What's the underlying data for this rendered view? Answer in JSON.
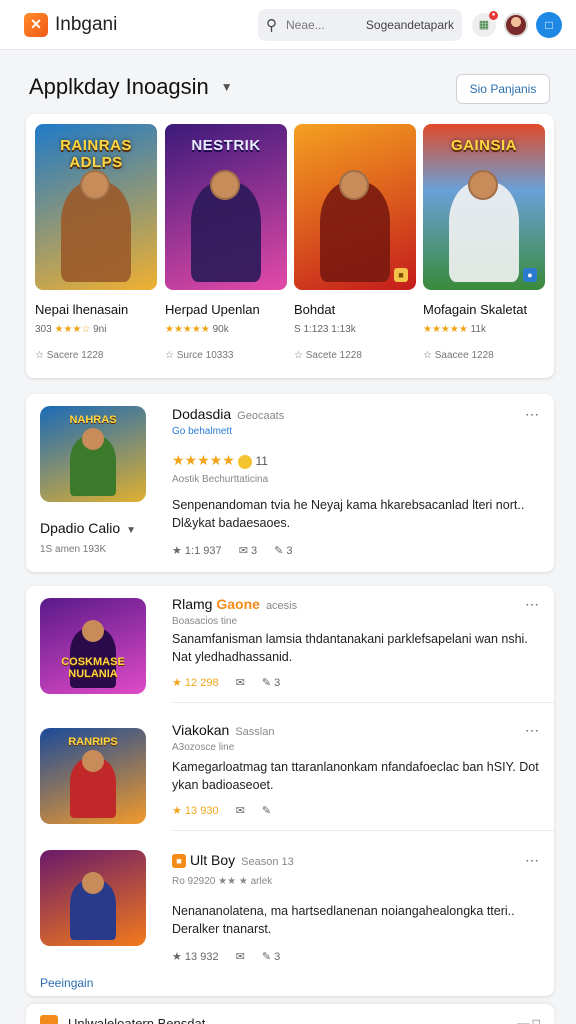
{
  "app": {
    "brand": "Inbgani",
    "logo_glyph": "✕"
  },
  "search": {
    "placeholder": "Neae...",
    "right_text": "Sogeandetapark"
  },
  "section": {
    "title": "Applkday Inoagsin",
    "button": "Sio Panjanis"
  },
  "featured": [
    {
      "art_title": "RAINRAS ADLPS",
      "name": "Nepai lhenasain",
      "meta_prefix": "303",
      "stars": "★★★☆",
      "meta_suffix": "9ni",
      "foot": "Sacere 1228",
      "colors": [
        "#1f7ac8",
        "#f0b030"
      ],
      "fig": "#9a5a2a"
    },
    {
      "art_title": "NESTRIK",
      "name": "Herpad Upenlan",
      "meta_prefix": "",
      "stars": "★★★★★",
      "meta_suffix": "90k",
      "foot": "Surce 10333",
      "colors": [
        "#3b1a7a",
        "#e44aa8"
      ],
      "fig": "#2a1a5a"
    },
    {
      "art_title": "",
      "name": "Bohdat",
      "meta_prefix": "S 1:123 1:13k",
      "stars": "",
      "meta_suffix": "",
      "foot": "Sacete 1228",
      "colors": [
        "#c41c1c",
        "#f5a020"
      ],
      "fig": "#7a1a10"
    },
    {
      "art_title": "GAINSIA",
      "name": "Mofagain Skaletat",
      "meta_prefix": "",
      "stars": "★★★★★",
      "meta_suffix": "11k",
      "foot": "Saacee 1228",
      "colors": [
        "#3a8a3a",
        "#e04a2a"
      ],
      "fig": "#f2f2f2"
    }
  ],
  "list1": {
    "title": "Dodasdia",
    "subtitle": "Geocaats",
    "link": "Go behalmett",
    "rating_value": "11",
    "attrib": "Aostik Bechurttaticina",
    "desc": "Senpenandoman tvia he Neyaj kama hkarebsacanlad lteri nort.. Dl&ykat badaesaoes.",
    "left_name": "Dpadio Calio",
    "left_sub": "1S amen 193K",
    "actions": [
      "★ 1:1 937",
      "✉ 3",
      "✎ 3"
    ]
  },
  "list2": [
    {
      "title": "Rlamg",
      "hl": "Gaone",
      "sub": "acesis",
      "small": "Boasacios tine",
      "desc": "Sanamfanisman lamsia thdantanakani parklefsapelani wan nshi. Nat yledhadhassanid.",
      "actions": [
        "★ 12 298",
        "✉",
        "✎ 3"
      ],
      "colors": [
        "#5a1a8a",
        "#e04ac8"
      ],
      "art": "COSKMASE NULANIA"
    },
    {
      "title": "Viakokan",
      "hl": "",
      "sub": "Sasslan",
      "small": "A3ozosce line",
      "desc": "Kamegarloatmag tan ttaranlanonkam nfandafoeclac ban hSIY. Dot ykan badioaseoet.",
      "actions": [
        "★ 13 930",
        "✉",
        "✎"
      ],
      "colors": [
        "#1a4a9a",
        "#f29a2a"
      ],
      "art": "RANRIPS"
    },
    {
      "title": "Ult Boy",
      "hl": "",
      "sub": "Season 13",
      "small": "Ro 92920 ★★ ★ arlek",
      "desc": "Nenananolatena, ma hartsedlanenan noiangahealongka tteri.. Deralker tnanarst.",
      "actions": [
        "★ 13 932",
        "✉",
        "✎ 3"
      ],
      "colors": [
        "#6a1a6a",
        "#f27a1a"
      ],
      "art": ""
    }
  ],
  "more_link": "Peeingain",
  "bottom": {
    "title": "Unlwaleloatern Bensdat"
  }
}
